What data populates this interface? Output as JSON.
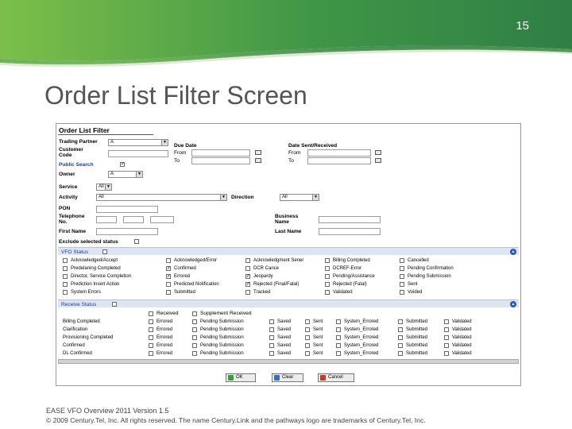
{
  "slide": {
    "number": "15",
    "title": "Order List Filter Screen",
    "footer_line1": "EASE VFO Overview 2011 Version 1.5",
    "footer_line2": "© 2009 Century.Tel, Inc. All rights reserved. The name Century.Link and the pathways logo are trademarks of Century.Tel, Inc."
  },
  "colors": {
    "band_green": "#3a8c3c",
    "title_gray": "#555555",
    "section_bar": "#dde5f2",
    "section_text": "#1c3f94"
  },
  "filter": {
    "heading": "Order List Filter",
    "trading_partner_label": "Trading Partner",
    "trading_partner_value": "A",
    "customer_code_label_1": "Customer",
    "customer_code_label_2": "Code",
    "public_search_label": "Public Search",
    "owner_label": "Owner",
    "owner_value": "A",
    "due_date_label": "Due Date",
    "from_label": "From",
    "to_label": "To",
    "date_sent_label": "Date Sent/Received",
    "service_label": "Service",
    "service_value": "All",
    "activity_label": "Activity",
    "activity_value": "All",
    "direction_label": "Direction",
    "direction_value": "All",
    "pon_label": "PON",
    "telephone_label_1": "Telephone",
    "telephone_label_2": "No.",
    "business_name_label_1": "Business",
    "business_name_label_2": "Name",
    "first_name_label": "First Name",
    "last_name_label": "Last Name",
    "exclude_label": "Exclude selected status"
  },
  "vfo_status": {
    "label": "VFO Status",
    "columns": [
      [
        {
          "label": "Acknowledged/Accept",
          "checked": false
        },
        {
          "label": "Predelaning Completed",
          "checked": false
        },
        {
          "label": "Director, Service Completion",
          "checked": false
        },
        {
          "label": "Prediction Insert Action",
          "checked": false
        },
        {
          "label": "System Errors",
          "checked": false
        }
      ],
      [
        {
          "label": "Acknowledged/Error",
          "checked": false
        },
        {
          "label": "Confirmed",
          "checked": true
        },
        {
          "label": "Errored",
          "checked": true
        },
        {
          "label": "Predicted Notification",
          "checked": false
        },
        {
          "label": "Submitted",
          "checked": false
        }
      ],
      [
        {
          "label": "Acknowledgment Sener",
          "checked": false
        },
        {
          "label": "DCR Cance",
          "checked": false
        },
        {
          "label": "Jeopardy",
          "checked": true
        },
        {
          "label": "Rejected (Final/Fatal)",
          "checked": true
        },
        {
          "label": "Tracked",
          "checked": false
        }
      ],
      [
        {
          "label": "Billing Completed",
          "checked": false
        },
        {
          "label": "DCREF-Error",
          "checked": false
        },
        {
          "label": "Pending/Assistance",
          "checked": false
        },
        {
          "label": "Rejected (Fatal)",
          "checked": false
        },
        {
          "label": "Validated",
          "checked": false
        }
      ],
      [
        {
          "label": "Cancelled",
          "checked": false
        },
        {
          "label": "Pending Confirmation",
          "checked": false
        },
        {
          "label": "Pending Submission",
          "checked": false
        },
        {
          "label": "Sent",
          "checked": false
        },
        {
          "label": "Voided",
          "checked": false
        }
      ]
    ]
  },
  "receive_status": {
    "label": "Receive Status",
    "row_labels": [
      "Billing Completed",
      "Clarification",
      "Provisioning Completed",
      "Confirmed",
      "DL Confirmed"
    ],
    "header_labels": [
      "Received",
      "Supplement Received"
    ],
    "columns": [
      [
        "Errored",
        "Errored",
        "Errored",
        "Errored",
        "Errored"
      ],
      [
        "Pending Submission",
        "Pending Submission",
        "Pending Submission",
        "Pending Submission",
        "Pending Submission"
      ],
      [
        "Saved",
        "Saved",
        "Saved",
        "Saved",
        "Saved"
      ],
      [
        "Sent",
        "Sent",
        "Sent",
        "Sent",
        "Sent"
      ],
      [
        "System_Errored",
        "System_Errored",
        "System_Errored",
        "System_Errored",
        "System_Errored"
      ],
      [
        "Submitted",
        "Submitted",
        "Submitted",
        "Submitted",
        "Submitted"
      ],
      [
        "Validated",
        "Validated",
        "Validated",
        "Validated",
        "Validated"
      ]
    ]
  },
  "buttons": {
    "ok": "OK",
    "clear": "Clear",
    "cancel": "Cancel"
  }
}
